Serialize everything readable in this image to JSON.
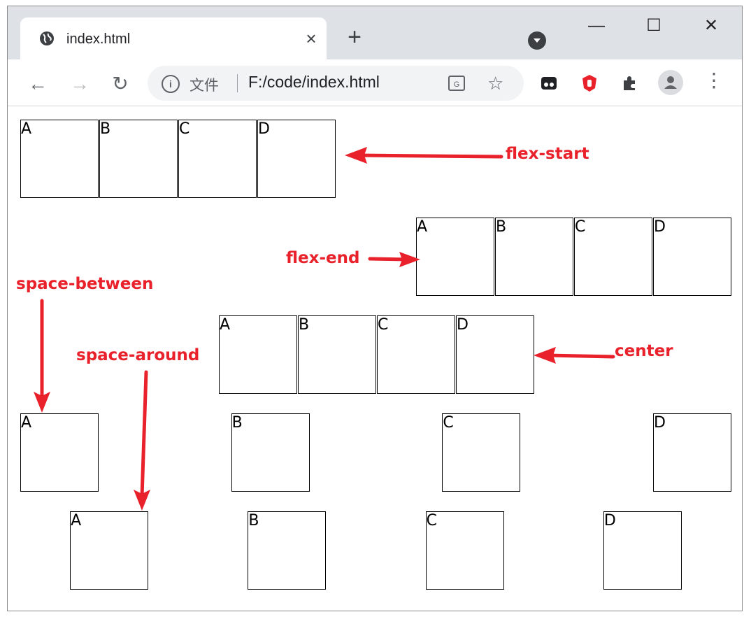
{
  "browser": {
    "tab_title": "index.html",
    "tab_close": "×",
    "new_tab": "+",
    "window_buttons": {
      "minimize": "—",
      "maximize": "☐",
      "close": "✕"
    },
    "nav": {
      "back": "←",
      "forward": "→",
      "reload": "↻"
    },
    "omnibox": {
      "info": "i",
      "scheme_label": "文件",
      "url": "F:/code/index.html"
    },
    "star": "☆",
    "menu": "⋮",
    "icons": [
      "globe-icon",
      "close-icon",
      "plus-icon",
      "profile-dropdown-icon",
      "minimize-icon",
      "maximize-icon",
      "window-close-icon",
      "back-icon",
      "forward-icon",
      "reload-icon",
      "info-icon",
      "translate-icon",
      "star-icon",
      "extension-mask-icon",
      "extension-shield-icon",
      "puzzle-icon",
      "avatar-icon",
      "kebab-menu-icon"
    ]
  },
  "page": {
    "rows": [
      {
        "mode": "flex-start",
        "items": [
          "A",
          "B",
          "C",
          "D"
        ]
      },
      {
        "mode": "flex-end",
        "items": [
          "A",
          "B",
          "C",
          "D"
        ]
      },
      {
        "mode": "center",
        "items": [
          "A",
          "B",
          "C",
          "D"
        ]
      },
      {
        "mode": "space-between",
        "items": [
          "A",
          "B",
          "C",
          "D"
        ]
      },
      {
        "mode": "space-around",
        "items": [
          "A",
          "B",
          "C",
          "D"
        ]
      }
    ],
    "annotations": {
      "flex_start": "flex-start",
      "flex_end": "flex-end",
      "center": "center",
      "space_between": "space-between",
      "space_around": "space-around"
    },
    "annotation_color": "#e8212b"
  }
}
